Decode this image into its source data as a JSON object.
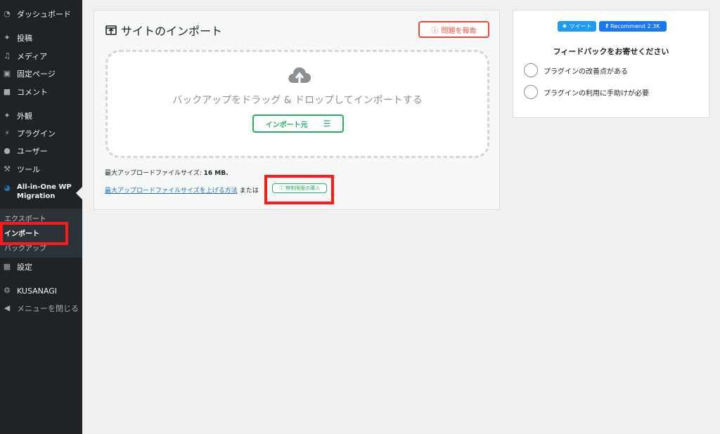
{
  "sidebar": {
    "items": [
      {
        "label": "ダッシュボード",
        "icon": "dashboard-icon"
      },
      {
        "label": "投稿",
        "icon": "pin-icon"
      },
      {
        "label": "メディア",
        "icon": "media-icon"
      },
      {
        "label": "固定ページ",
        "icon": "page-icon"
      },
      {
        "label": "コメント",
        "icon": "comment-icon"
      },
      {
        "label": "外観",
        "icon": "appearance-icon"
      },
      {
        "label": "プラグイン",
        "icon": "plugin-icon"
      },
      {
        "label": "ユーザー",
        "icon": "user-icon"
      },
      {
        "label": "ツール",
        "icon": "wrench-icon"
      },
      {
        "label": "All-in-One WP Migration",
        "icon": "migration-icon"
      },
      {
        "label": "設定",
        "icon": "settings-icon"
      },
      {
        "label": "KUSANAGI",
        "icon": "gear-icon"
      },
      {
        "label": "メニューを閉じる",
        "icon": "collapse-icon"
      }
    ],
    "plugin_label_line1": "All-in-One WP",
    "plugin_label_line2": "Migration",
    "submenu": {
      "export": "エクスポート",
      "import": "インポート",
      "backup": "バックアップ"
    }
  },
  "main": {
    "title": "サイトのインポート",
    "report_button": "問題を報告",
    "drop_text": "バックアップをドラッグ & ドロップしてインポートする",
    "import_button": "インポート元",
    "max_size_label": "最大アップロードファイルサイズ:",
    "max_size_value": "16 MB.",
    "increase_link": "最大アップロードファイルサイズを上げる方法",
    "or_text": "または",
    "unlimited_button": "無制限版の購入"
  },
  "right_panel": {
    "tweet_label": "ツイート",
    "recommend_label": "Recommend 2.3K",
    "feedback_title": "フィードバックをお寄せください",
    "options": [
      "プラグインの改善点がある",
      "プラグインの利用に手助けが必要"
    ]
  },
  "colors": {
    "sidebar_bg": "#1d2327",
    "accent_green": "#27ae60",
    "report_red": "#e74c3c",
    "highlight_red": "#ff1a1a",
    "link_blue": "#2271b1"
  }
}
